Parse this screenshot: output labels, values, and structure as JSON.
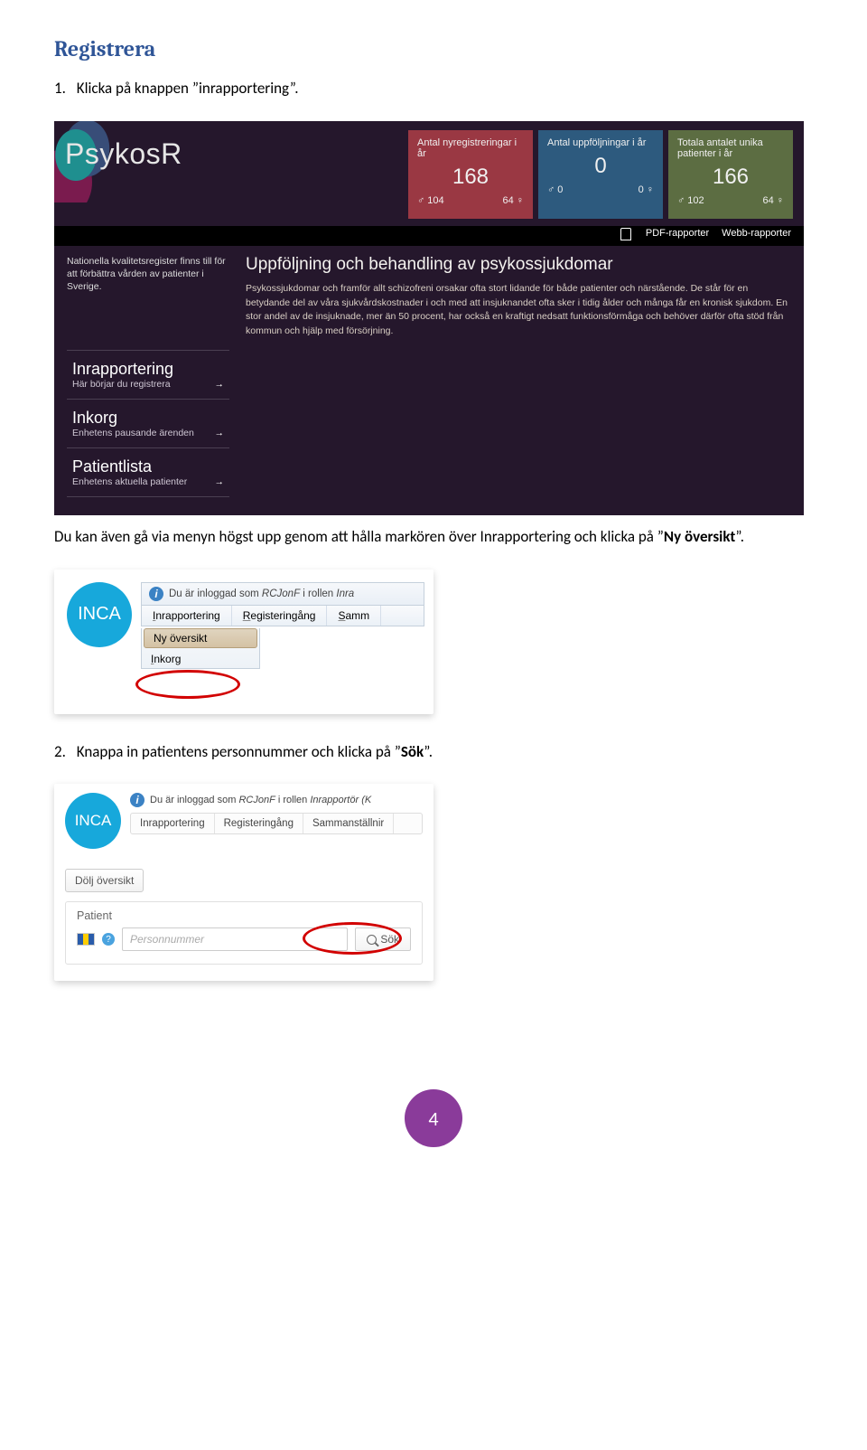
{
  "h2": "Registrera",
  "step1": {
    "num": "1.",
    "text": "Klicka på knappen ”inrapportering”."
  },
  "shot1": {
    "brand": "PsykosR",
    "stats": [
      {
        "cls": "red",
        "label": "Antal nyregistreringar i år",
        "value": "168",
        "male": "♂ 104",
        "female": "64 ♀"
      },
      {
        "cls": "blue",
        "label": "Antal uppföljningar i år",
        "value": "0",
        "male": "♂ 0",
        "female": "0 ♀"
      },
      {
        "cls": "green",
        "label": "Totala antalet unika patienter i år",
        "value": "166",
        "male": "♂ 102",
        "female": "64 ♀"
      }
    ],
    "pdfLinks": {
      "a": "PDF-rapporter",
      "b": "Webb-rapporter"
    },
    "leftIntro": "Nationella kvalitetsregister finns till för att förbättra vården av patienter i Sverige.",
    "rightTitle": "Uppföljning och behandling av psykossjukdomar",
    "rightBody": "Psykossjukdomar och framför allt schizofreni orsakar ofta stort lidande för både patienter och närstående. De står för en betydande del av våra sjukvårdskostnader i och med att insjuknandet ofta sker i tidig ålder och många får en kronisk sjukdom. En stor andel av de insjuknade, mer än 50 procent, har också en kraftigt nedsatt funktionsförmåga och behöver därför ofta stöd från kommun och hjälp med försörjning.",
    "nav": [
      {
        "title": "Inrapportering",
        "sub": "Här börjar du registrera"
      },
      {
        "title": "Inkorg",
        "sub": "Enhetens pausande ärenden"
      },
      {
        "title": "Patientlista",
        "sub": "Enhetens aktuella patienter"
      }
    ]
  },
  "para2": {
    "pre": "Du kan även gå via menyn högst upp genom att hålla markören över Inrapportering och klicka på ”",
    "bold": "Ny översikt",
    "post": "”."
  },
  "shot2": {
    "logo": "INCA",
    "loginText": "Du är inloggad som RCJonF i rollen Inra",
    "menu": {
      "a": "Inrapportering",
      "b": "Registeringång",
      "c": "Samm"
    },
    "dd": {
      "selected": "Ny översikt",
      "other": "Inkorg"
    }
  },
  "step3": {
    "num": "2.",
    "pre": "Knappa in patientens personnummer och klicka på ”",
    "bold": "Sök",
    "post": "”."
  },
  "shot3": {
    "logo": "INCA",
    "loginText": "Du är inloggad som RCJonF i rollen Inrapportör (K",
    "menu": {
      "a": "Inrapportering",
      "b": "Registeringång",
      "c": "Sammanställnir"
    },
    "hideBtn": "Dölj översikt",
    "panelTitle": "Patient",
    "placeholder": "Personnummer",
    "searchLabel": "Sök"
  },
  "pageNumber": "4"
}
